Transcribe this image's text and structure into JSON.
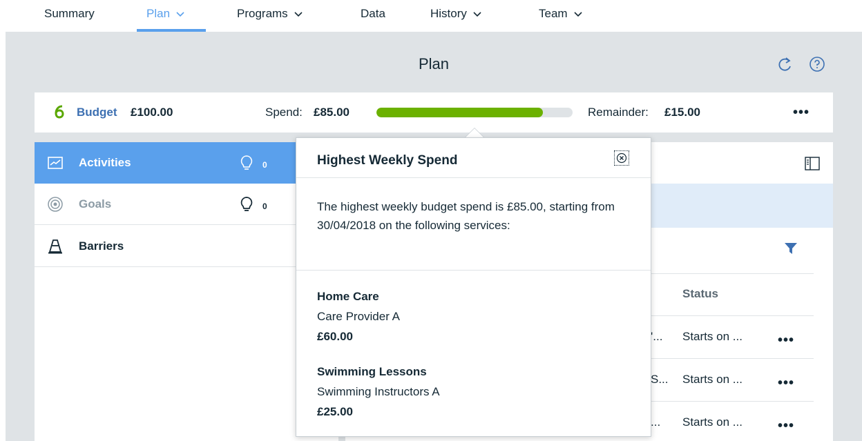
{
  "nav": {
    "tabs": [
      {
        "label": "Summary",
        "has_dropdown": false
      },
      {
        "label": "Plan",
        "has_dropdown": true,
        "active": true
      },
      {
        "label": "Programs",
        "has_dropdown": true
      },
      {
        "label": "Data",
        "has_dropdown": false
      },
      {
        "label": "History",
        "has_dropdown": true
      },
      {
        "label": "Team",
        "has_dropdown": true
      }
    ]
  },
  "page": {
    "title": "Plan",
    "icons": [
      "refresh-icon",
      "help-icon"
    ]
  },
  "budget": {
    "icon": "budget-six-icon",
    "label": "Budget",
    "amount": "£100.00",
    "spend_label": "Spend:",
    "spend_value": "£85.00",
    "spend_fraction": 0.85,
    "remainder_label": "Remainder:",
    "remainder_value": "£15.00",
    "more_label": "•••"
  },
  "sidebar": {
    "items": [
      {
        "label": "Activities",
        "icon": "activities-chart-icon",
        "count": "0",
        "active": true
      },
      {
        "label": "Goals",
        "icon": "target-icon",
        "count": "0"
      },
      {
        "label": "Barriers",
        "icon": "traffic-cone-icon"
      }
    ]
  },
  "table": {
    "status_header": "Status",
    "rows": [
      {
        "truncated": "'...",
        "status": "Starts on ...",
        "more": "•••"
      },
      {
        "truncated": "S...",
        "status": "Starts on ...",
        "more": "•••"
      },
      {
        "truncated": "...",
        "status": "Starts on ...",
        "more": "•••"
      }
    ]
  },
  "popover": {
    "title": "Highest Weekly Spend",
    "body": "The highest weekly budget spend is £85.00, starting from 30/04/2018 on the following services:",
    "services": [
      {
        "name": "Home Care",
        "provider": "Care Provider A",
        "amount": "£60.00"
      },
      {
        "name": "Swimming Lessons",
        "provider": "Swimming Instructors A",
        "amount": "£25.00"
      }
    ]
  },
  "colors": {
    "accent": "#5aa0ec",
    "progress": "#6bb100",
    "link": "#3d70b2",
    "budget_icon": "#5aa700",
    "filter": "#3d70b2"
  }
}
